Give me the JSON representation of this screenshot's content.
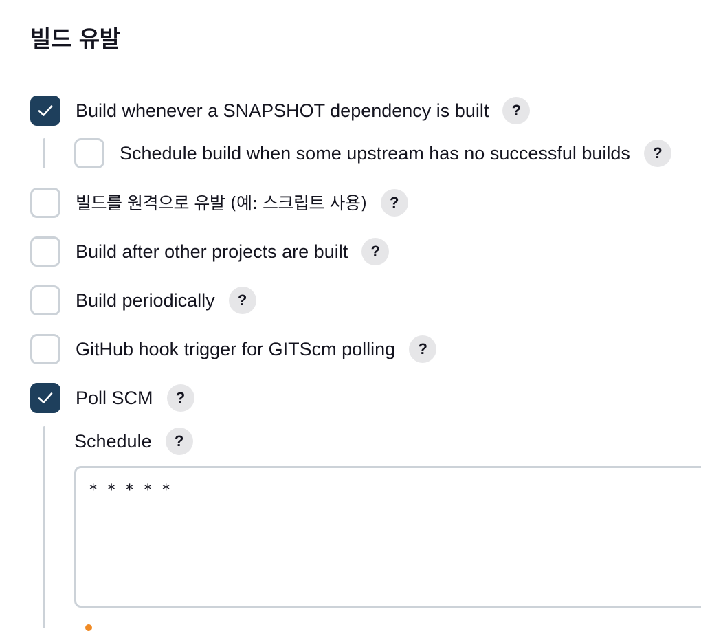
{
  "section": {
    "title": "빌드 유발"
  },
  "triggers": [
    {
      "label": "Build whenever a SNAPSHOT dependency is built",
      "checked": true
    },
    {
      "label": "Schedule build when some upstream has no successful builds",
      "checked": false
    },
    {
      "label": "빌드를 원격으로 유발 (예: 스크립트 사용)",
      "checked": false
    },
    {
      "label": "Build after other projects are built",
      "checked": false
    },
    {
      "label": "Build periodically",
      "checked": false
    },
    {
      "label": "GitHub hook trigger for GITScm polling",
      "checked": false
    },
    {
      "label": "Poll SCM",
      "checked": true
    }
  ],
  "help_glyph": "?",
  "schedule": {
    "label": "Schedule",
    "value": "* * * * *"
  },
  "colors": {
    "checked": "#1e3f5c",
    "unchecked_border": "#ccd2d8",
    "help_bg": "#e6e6e8"
  }
}
